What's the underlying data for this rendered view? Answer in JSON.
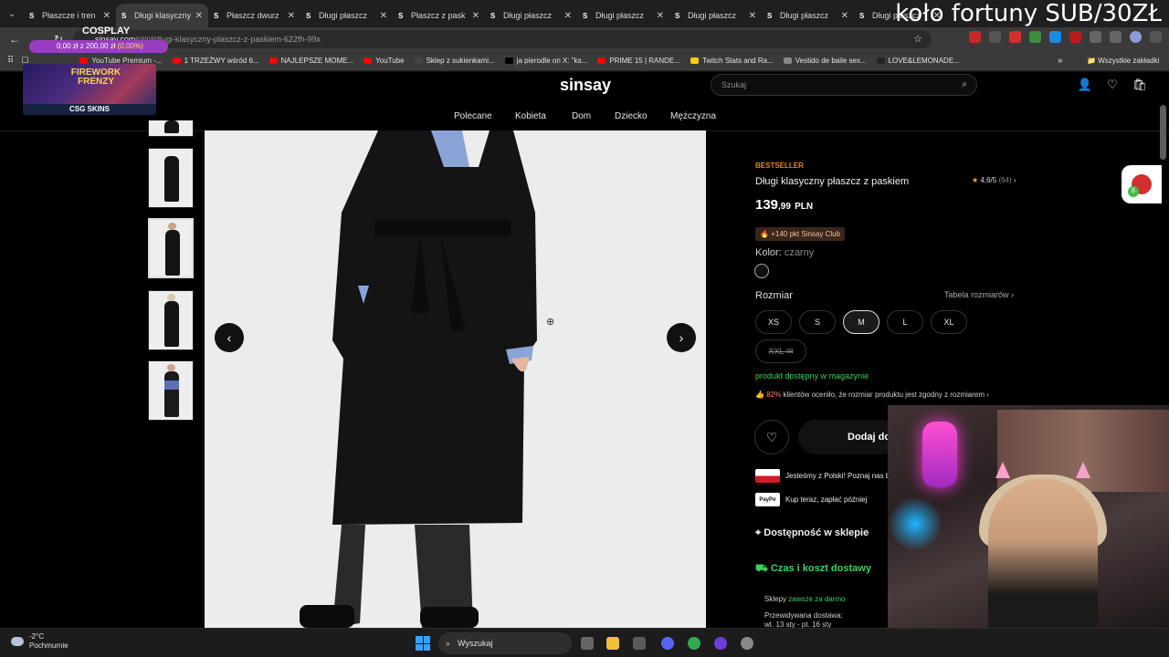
{
  "browser": {
    "tabs": [
      {
        "label": "Płaszcze i tren",
        "favicon": "S"
      },
      {
        "label": "Długi klasyczny",
        "favicon": "S",
        "active": true
      },
      {
        "label": "Płaszcz dwurz",
        "favicon": "S"
      },
      {
        "label": "Długi płaszcz",
        "favicon": "S"
      },
      {
        "label": "Płaszcz z pask",
        "favicon": "S"
      },
      {
        "label": "Długi płaszcz",
        "favicon": "S"
      },
      {
        "label": "Długi płaszcz",
        "favicon": "S"
      },
      {
        "label": "Długi płaszcz",
        "favicon": "S"
      },
      {
        "label": "Długi płaszcz",
        "favicon": "S"
      },
      {
        "label": "Długi płaszcz",
        "favicon": "S"
      }
    ],
    "url_domain": "sinsay.com",
    "url_path": "/pl/pl/dlugi-klasyczny-plaszcz-z-paskiem-622fh-99x",
    "bookmarks": [
      {
        "label": "YouTube Premium -...",
        "color": "#ff0000"
      },
      {
        "label": "1 TRZEŹWY wśród 6...",
        "color": "#ff0000"
      },
      {
        "label": "NAJLEPSZE MOME...",
        "color": "#ff0000"
      },
      {
        "label": "YouTube",
        "color": "#ff0000"
      },
      {
        "label": "Sklep z sukienkami...",
        "color": "#444444"
      },
      {
        "label": "ja pierodle on X: \"ks...",
        "color": "#000000"
      },
      {
        "label": "PRIME 15 | RANDE...",
        "color": "#ff0000"
      },
      {
        "label": "Twitch Stats and Ra...",
        "color": "#ffcc00"
      },
      {
        "label": "Vestido de baile sex...",
        "color": "#888888"
      },
      {
        "label": "LOVE&LEMONADE...",
        "color": "#222222"
      }
    ],
    "all_bookmarks": "Wszystkie zakładki"
  },
  "stream_overlay": {
    "title": "koło fortuny SUB/30ZŁ",
    "goal_title": "COSPLAY",
    "goal_progress_text": "0,00 zł z 200,00 zł",
    "goal_percent": "(0.00%)",
    "promo_title": "FIREWORK FRENZY",
    "promo_brand": "CSG SKINS",
    "badge_count": "6"
  },
  "site": {
    "brand": "sinsay",
    "search_placeholder": "Szukaj",
    "categories": [
      "Polecane",
      "Kobieta",
      "Dom",
      "Dziecko",
      "Mężczyzna"
    ]
  },
  "product": {
    "badge": "BESTSELLER",
    "title": "Długi klasyczny płaszcz z paskiem",
    "rating": "4,6/5",
    "rating_count": "(64)",
    "price_main": "139",
    "price_dec": ",99",
    "currency": "PLN",
    "club_points": "+140 pkt Sinsay Club",
    "color_label": "Kolor:",
    "color_value": "czarny",
    "size_label": "Rozmiar",
    "size_chart_link": "Tabela rozmiarów",
    "sizes": [
      "XS",
      "S",
      "M",
      "L",
      "XL",
      "XXL"
    ],
    "selected_size": "M",
    "availability": "produkt dostępny w magazynie",
    "fit_percent": "82%",
    "fit_text": "klientów oceniło, że rozmiar produktu jest zgodny z rozmiarem",
    "add_to_cart": "Dodaj do",
    "poland_info": "Jesteśmy z Polski! Poznaj nas b",
    "paypo_info": "Kup teraz, zapłać później",
    "store_availability": "Dostępność w sklepie",
    "delivery_header": "Czas i koszt dostawy",
    "shops_label": "Sklepy",
    "shops_value": "zawsze za darmo",
    "expected_delivery": "Przewidywana dostawa:",
    "expected_dates": "wt. 13 sty - pt. 16 sty"
  },
  "taskbar": {
    "temperature": "-2°C",
    "weather": "Pochmurnie",
    "search_label": "Wyszukaj"
  }
}
